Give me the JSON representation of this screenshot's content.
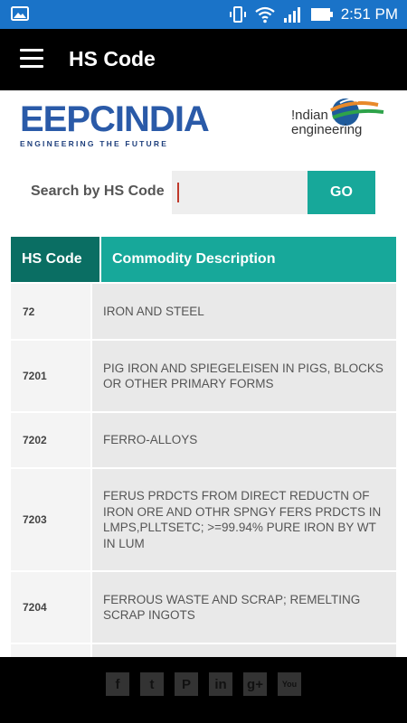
{
  "status_bar": {
    "time": "2:51 PM"
  },
  "app_bar": {
    "title": "HS Code"
  },
  "logos": {
    "left_word": "EEPCINDIA",
    "left_tagline": "ENGINEERING THE FUTURE",
    "right_text_line1": "!ndian",
    "right_text_line2": "engineering"
  },
  "search": {
    "label": "Search by HS Code",
    "placeholder": "",
    "value": "",
    "button_label": "GO"
  },
  "table": {
    "headers": [
      "HS Code",
      "Commodity Description"
    ],
    "rows": [
      {
        "code": "72",
        "description": "IRON AND STEEL"
      },
      {
        "code": "7201",
        "description": "PIG IRON AND SPIEGELEISEN IN PIGS, BLOCKS OR OTHER PRIMARY FORMS"
      },
      {
        "code": "7202",
        "description": "FERRO-ALLOYS"
      },
      {
        "code": "7203",
        "description": "FERUS PRDCTS FROM DIRECT REDUCTN OF IRON ORE AND OTHR SPNGY FERS PRDCTS IN LMPS,PLLTSETC; >=99.94% PURE IRON BY WT IN LUM"
      },
      {
        "code": "7204",
        "description": "FERROUS WASTE AND SCRAP; REMELTING SCRAP INGOTS"
      },
      {
        "code": "",
        "description": ""
      }
    ]
  },
  "footer": {
    "social": [
      {
        "name": "facebook-icon",
        "glyph": "f"
      },
      {
        "name": "twitter-icon",
        "glyph": "t"
      },
      {
        "name": "pinterest-icon",
        "glyph": "P"
      },
      {
        "name": "linkedin-icon",
        "glyph": "in"
      },
      {
        "name": "googleplus-icon",
        "glyph": "g+"
      },
      {
        "name": "youtube-icon",
        "glyph": "You"
      }
    ]
  },
  "colors": {
    "status_bar": "#1a73c8",
    "app_bar": "#000000",
    "accent": "#17a89a",
    "accent_dark": "#0a6e63",
    "brand_blue": "#2a5aa8"
  }
}
